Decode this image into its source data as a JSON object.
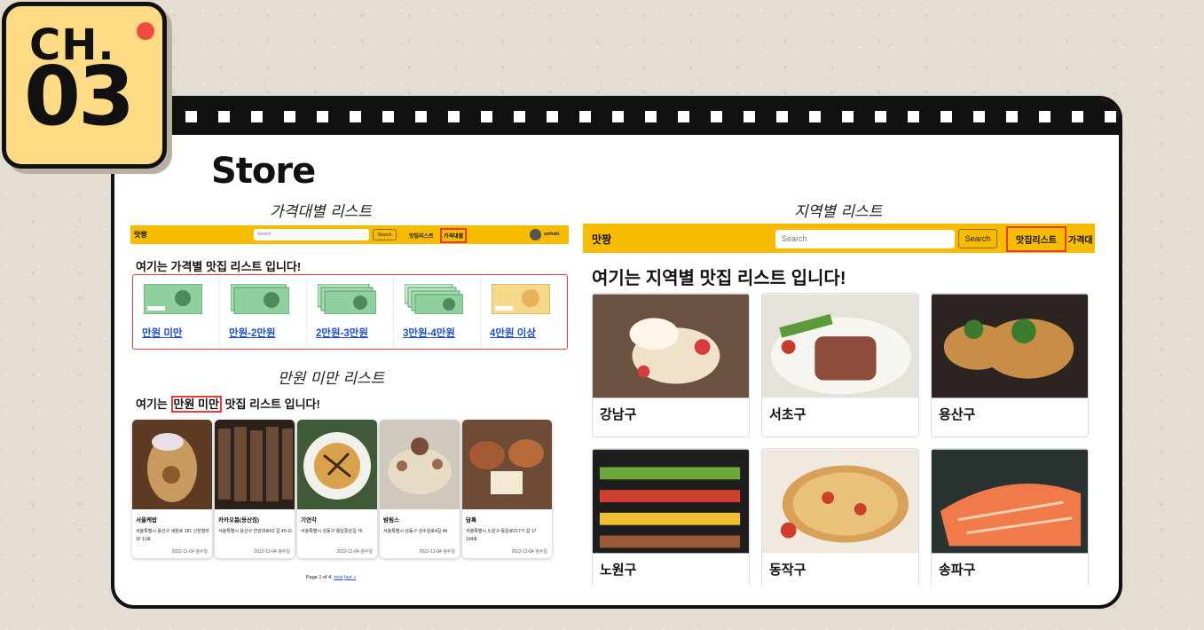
{
  "badge": {
    "chapter": "CH.",
    "number": "03"
  },
  "title": "Store",
  "captions": {
    "price_list": "가격대별 리스트",
    "region_list": "지역별 리스트",
    "under_10k_list": "만원 미만 리스트"
  },
  "left_nav": {
    "brand": "맛짱",
    "search_placeholder": "Search",
    "search_button": "Search",
    "link_list": "맛집리스트",
    "link_price": "가격대별",
    "user": "smhski"
  },
  "price_section": {
    "heading": "여기는 가격별 맛집 리스트 입니다!",
    "items": [
      {
        "label": "만원 미만"
      },
      {
        "label": "만원-2만원"
      },
      {
        "label": "2만원-3만원"
      },
      {
        "label": "3만원-4만원"
      },
      {
        "label": "4만원 이상"
      }
    ]
  },
  "under_section": {
    "heading_prefix": "여기는",
    "heading_highlight": "만원 미만",
    "heading_suffix": "맛집 리스트 입니다!"
  },
  "restaurants": [
    {
      "name": "서울케밥",
      "address": "서울특별시 용산구 세창로 181 신한빌라 1F 11호",
      "date": "2022-11-04 검수일"
    },
    {
      "name": "카카오봄(용산점)",
      "address": "서울특별시 용산구 한강대로62 길 45-11",
      "date": "2022-11-04 검수일"
    },
    {
      "name": "기연각",
      "address": "서울특별시 성동구 용답중앙길 76",
      "date": "2022-11-04 검수일"
    },
    {
      "name": "밤림스",
      "address": "서울특별시 성동구 성수일로4길 49",
      "date": "2022-11-04 검수일"
    },
    {
      "name": "담록",
      "address": "서울특별시 노원구 동일로217가 길 17 104호",
      "date": "2022-11-04 검수일"
    }
  ],
  "pager": {
    "text": "Page 1 of 4.",
    "next": "next",
    "last": "last »"
  },
  "right_nav": {
    "brand": "맛짱",
    "search_placeholder": "Search",
    "search_button": "Search",
    "link_list": "맛집리스트",
    "link_price": "가격대"
  },
  "region_section": {
    "heading": "여기는 지역별 맛집 리스트 입니다!",
    "regions": [
      {
        "name": "강남구"
      },
      {
        "name": "서초구"
      },
      {
        "name": "용산구"
      },
      {
        "name": "노원구"
      },
      {
        "name": "동작구"
      },
      {
        "name": "송파구"
      }
    ]
  },
  "colors": {
    "accent": "#f7bb00",
    "highlight": "#e43c3c",
    "link": "#1a4fd1",
    "badge": "#ffdb86"
  }
}
